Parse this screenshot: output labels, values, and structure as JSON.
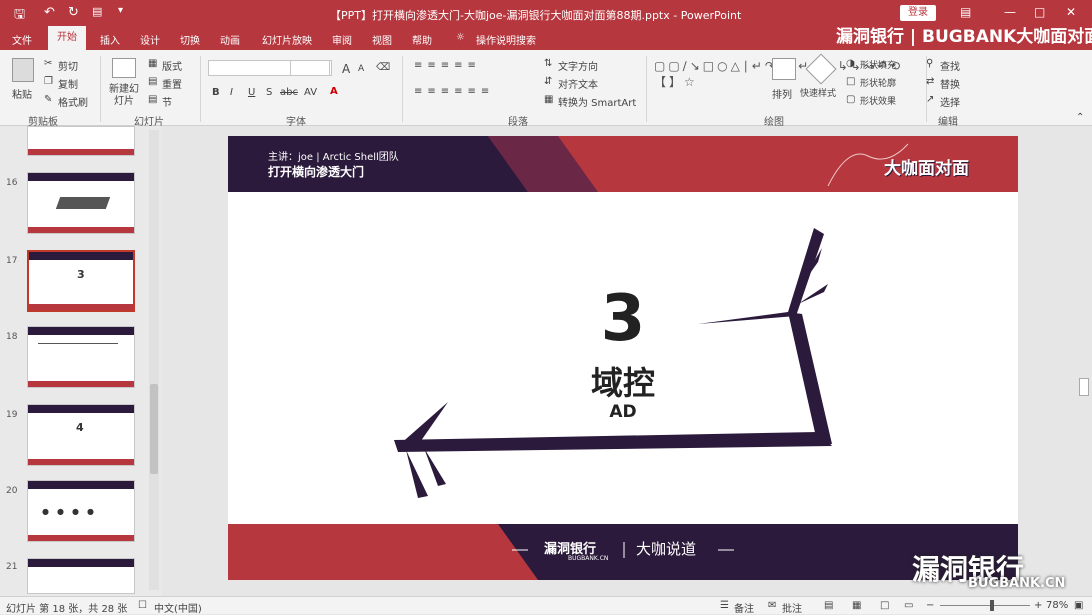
{
  "titlebar": {
    "title": "【PPT】打开横向渗透大门-大咖joe-漏洞银行大咖面对面第88期.pptx - PowerPoint",
    "login": "登录",
    "save_icon": "save-icon",
    "undo_icon": "undo-icon",
    "redo_icon": "redo-icon"
  },
  "tabs": [
    "文件",
    "开始",
    "插入",
    "设计",
    "切换",
    "动画",
    "幻灯片放映",
    "审阅",
    "视图",
    "帮助",
    "操作说明搜索"
  ],
  "watermark_top": "漏洞银行 | BUGBANK大咖面对面",
  "ribbon": {
    "clipboard": {
      "paste": "粘贴",
      "cut": "剪切",
      "copy": "复制",
      "format_painter": "格式刷",
      "group": "剪贴板"
    },
    "slides": {
      "new_slide": "新建幻灯片",
      "layout": "版式",
      "reset": "重置",
      "section": "节",
      "group": "幻灯片"
    },
    "font": {
      "group": "字体",
      "bold": "B",
      "italic": "I",
      "underline": "U",
      "strike": "S",
      "spacing": "abc",
      "case": "AV",
      "grow": "A",
      "shrink": "A"
    },
    "paragraph": {
      "group": "段落",
      "text_direction": "文字方向",
      "align_text": "对齐文本",
      "smartart": "转换为 SmartArt"
    },
    "drawing": {
      "group": "绘图",
      "arrange": "排列",
      "quick_styles": "快速样式",
      "shape_fill": "形状填充",
      "shape_outline": "形状轮廓",
      "shape_effects": "形状效果"
    },
    "editing": {
      "group": "编辑",
      "find": "查找",
      "replace": "替换",
      "select": "选择"
    }
  },
  "thumbnails": [
    {
      "num": "",
      "label": ""
    },
    {
      "num": "16",
      "label": ""
    },
    {
      "num": "17",
      "label": "3"
    },
    {
      "num": "18",
      "label": ""
    },
    {
      "num": "19",
      "label": "4"
    },
    {
      "num": "20",
      "label": ""
    },
    {
      "num": "21",
      "label": ""
    }
  ],
  "slide": {
    "speaker": "主讲：joe | Arctic Shell团队",
    "subject": "打开横向渗透大门",
    "badge": "大咖面对面",
    "number": "3",
    "title_cn": "域控",
    "title_en": "AD",
    "footer_logo": "漏洞银行",
    "footer_logo_sub": "BUGBANK.CN",
    "footer_tag": "大咖说道",
    "colors": {
      "header": "#b7373f",
      "dark": "#2b1a3b"
    }
  },
  "watermark_bottom": {
    "main": "漏洞银行",
    "sub": "BUGBANK.CN"
  },
  "status": {
    "slide_info": "幻灯片 第 18 张，共 28 张",
    "language": "中文(中国)",
    "notes": "备注",
    "comments": "批注",
    "zoom": "78%"
  }
}
